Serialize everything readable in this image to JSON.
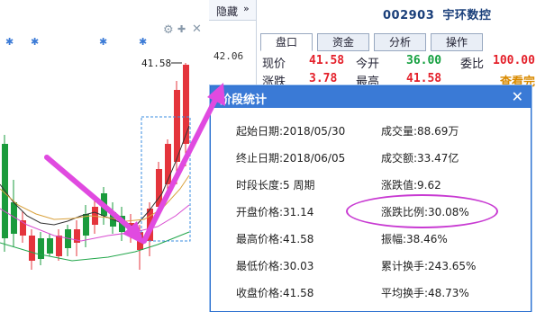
{
  "header": {
    "hide_label": "隐藏",
    "hide_arrow": "»",
    "price_tag": "42.06",
    "gear": "⚙",
    "tools": "✚",
    "close": "✕"
  },
  "stock": {
    "code": "002903",
    "name": "宇环数控"
  },
  "tabs": [
    "盘口",
    "资金",
    "分析",
    "操作"
  ],
  "quote": {
    "price_label": "现价",
    "price": "41.58",
    "open_label": "今开",
    "open": "36.00",
    "change_label": "涨跌",
    "change": "3.78",
    "high_label": "最高",
    "high": "41.58",
    "ratio_label": "委比",
    "ratio": "100.00",
    "view_all": "查看完"
  },
  "chart": {
    "peak_label": "41.58",
    "colors": {
      "up": "#e4343c",
      "down": "#1a9b3c",
      "ma5": "#333333",
      "ma10": "#d9a13b",
      "ma20": "#d84bd0",
      "ma60": "#21a64a",
      "arrow": "#dd44dd"
    }
  },
  "popup": {
    "title": "阶段统计",
    "close": "✕",
    "left": [
      {
        "label": "起始日期:",
        "value": "2018/05/30"
      },
      {
        "label": "终止日期:",
        "value": "2018/06/05"
      },
      {
        "label": "时段长度:",
        "value": "5 周期"
      },
      {
        "label": "开盘价格:",
        "value": "31.14"
      },
      {
        "label": "最高价格:",
        "value": "41.58"
      },
      {
        "label": "最低价格:",
        "value": "30.03"
      },
      {
        "label": "收盘价格:",
        "value": "41.58"
      }
    ],
    "right": [
      {
        "label": "成交量:",
        "value": "88.69万"
      },
      {
        "label": "成交额:",
        "value": "33.47亿"
      },
      {
        "label": "涨跌值:",
        "value": "9.62"
      },
      {
        "label": "涨跌比例:",
        "value": "30.08%"
      },
      {
        "label": "振幅:",
        "value": "38.46%"
      },
      {
        "label": "累计换手:",
        "value": "243.65%"
      },
      {
        "label": "平均换手:",
        "value": "48.73%"
      }
    ]
  }
}
